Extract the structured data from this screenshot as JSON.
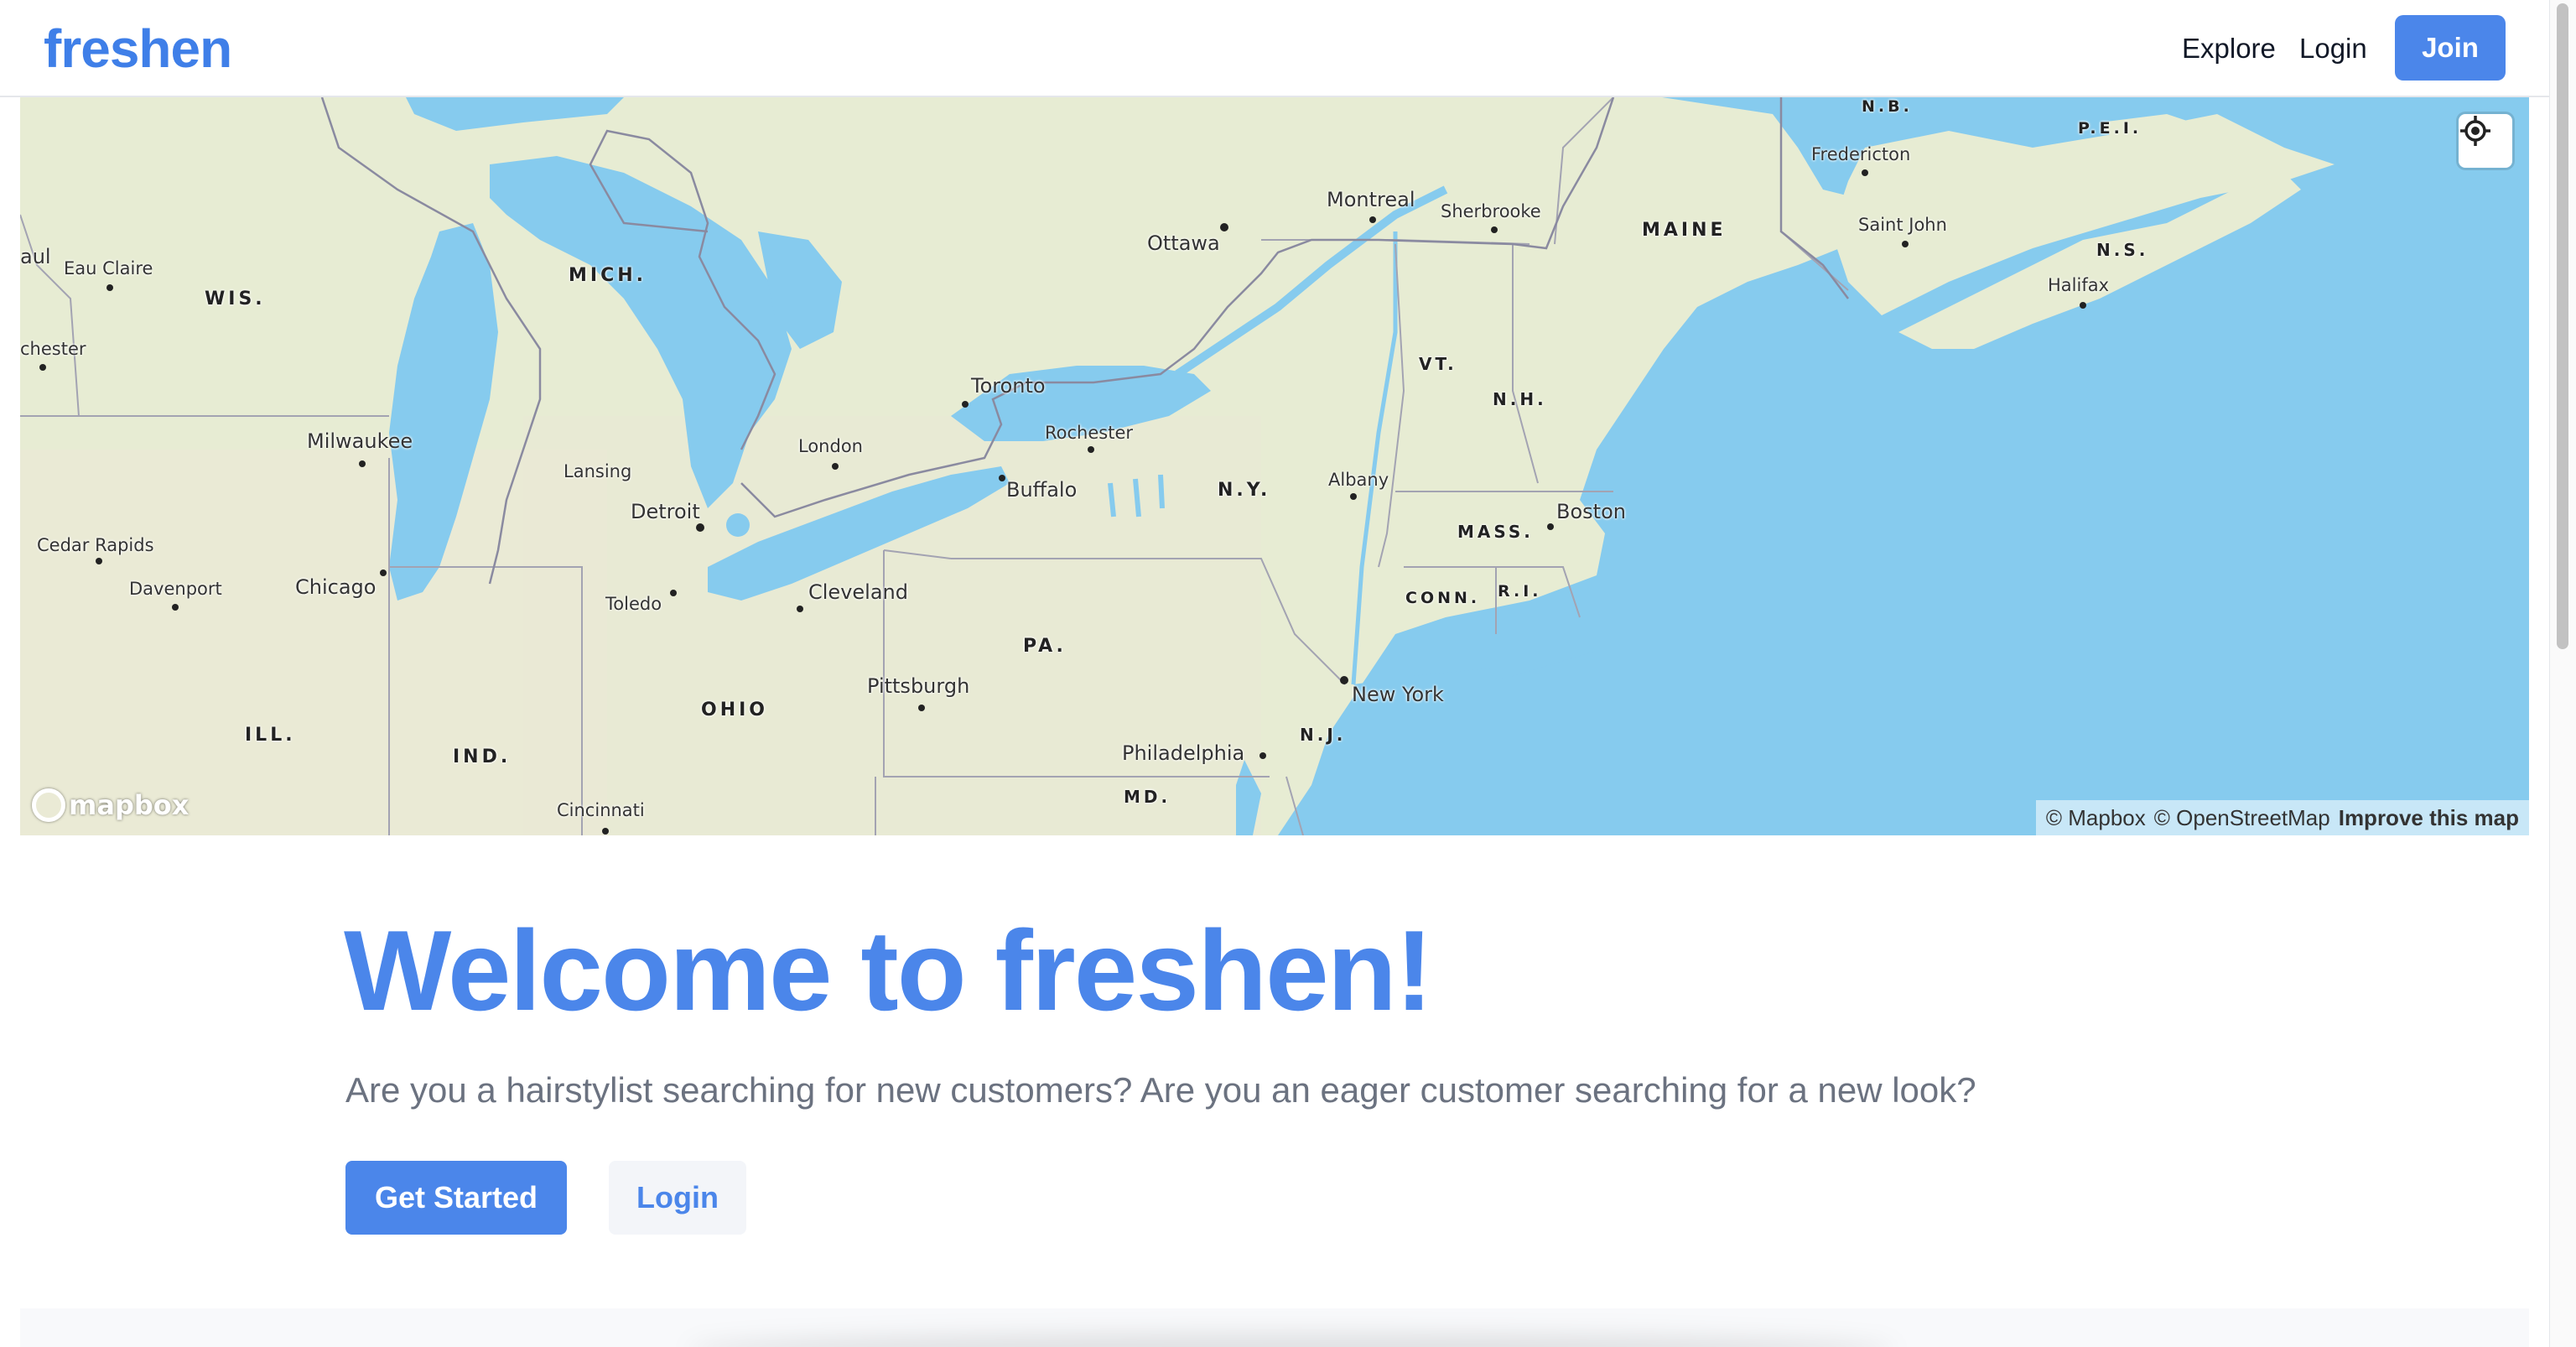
{
  "header": {
    "logo": "freshen",
    "nav": {
      "explore": "Explore",
      "login": "Login",
      "join": "Join"
    }
  },
  "map": {
    "labels": {
      "city_paul": "aul",
      "city_eau_claire": "Eau Claire",
      "state_wis": "WIS.",
      "city_rochester_mn": "chester",
      "state_mich": "MICH.",
      "city_milwaukee": "Milwaukee",
      "city_lansing": "Lansing",
      "city_detroit": "Detroit",
      "city_london": "London",
      "city_toronto": "Toronto",
      "city_rochester": "Rochester",
      "city_buffalo": "Buffalo",
      "city_ottawa": "Ottawa",
      "city_montreal": "Montreal",
      "city_sherbrooke": "Sherbrooke",
      "state_maine": "MAINE",
      "city_fredericton": "Fredericton",
      "state_nb": "N.B.",
      "state_pei": "P.E.I.",
      "city_saint_john": "Saint John",
      "state_ns": "N.S.",
      "city_halifax": "Halifax",
      "state_vt": "VT.",
      "state_nh": "N.H.",
      "state_ny": "N.Y.",
      "city_albany": "Albany",
      "state_mass": "MASS.",
      "city_boston": "Boston",
      "state_conn": "CONN.",
      "state_ri": "R.I.",
      "city_cedar_rapids": "Cedar Rapids",
      "city_davenport": "Davenport",
      "city_chicago": "Chicago",
      "city_toledo": "Toledo",
      "city_cleveland": "Cleveland",
      "state_pa": "PA.",
      "city_pittsburgh": "Pittsburgh",
      "state_ohio": "OHIO",
      "city_new_york": "New York",
      "state_nj": "N.J.",
      "city_philadelphia": "Philadelphia",
      "state_ill": "ILL.",
      "state_ind": "IND.",
      "state_md": "MD.",
      "city_cincinnati": "Cincinnati"
    },
    "mapbox_logo": "mapbox",
    "attribution": {
      "mapbox": "© Mapbox",
      "osm": "© OpenStreetMap",
      "improve": "Improve this map"
    }
  },
  "hero": {
    "title": "Welcome to freshen!",
    "subtitle": "Are you a hairstylist searching for new customers? Are you an eager customer searching for a new look?",
    "get_started": "Get Started",
    "login": "Login"
  },
  "colors": {
    "brand": "#4b86ea",
    "water": "#86cbee",
    "land": "#e8ecd4"
  }
}
